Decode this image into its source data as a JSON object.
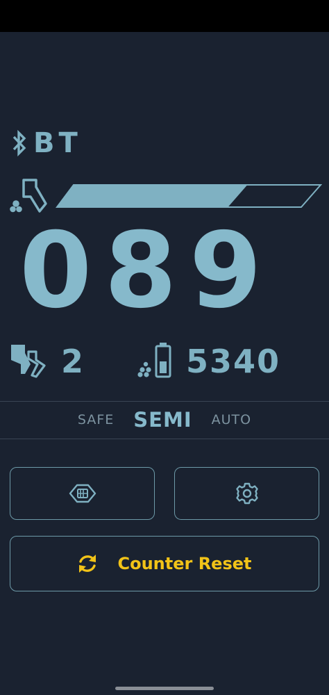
{
  "status": {
    "bluetooth_label": "BT"
  },
  "ammo": {
    "count": "089",
    "fill_fraction": 0.7
  },
  "reloads": {
    "value": "2"
  },
  "battery": {
    "value": "5340"
  },
  "fire_modes": {
    "options": [
      "SAFE",
      "SEMI",
      "AUTO"
    ],
    "selected": "SEMI"
  },
  "buttons": {
    "chip_icon": "chip-icon",
    "settings_icon": "gear-icon",
    "reset_icon": "refresh-icon",
    "reset_label": "Counter Reset"
  },
  "colors": {
    "background": "#1a2230",
    "accent": "#7fb1c2",
    "warning": "#f2c318"
  }
}
